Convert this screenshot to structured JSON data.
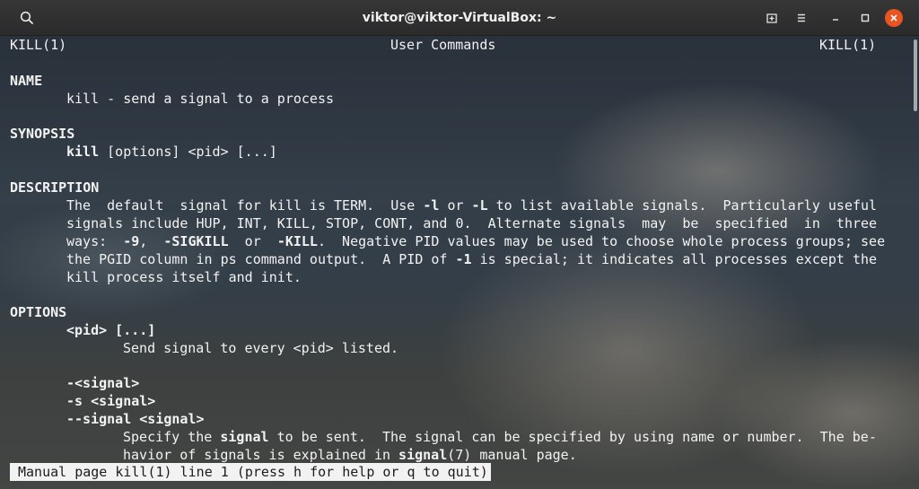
{
  "window": {
    "title": "viktor@viktor-VirtualBox: ~",
    "accent_color": "#e95420",
    "buttons": {
      "search_icon": "search-icon",
      "new_tab_icon": "new-tab-icon",
      "menu_icon": "hamburger-menu-icon",
      "minimize_icon": "minimize-icon",
      "maximize_icon": "maximize-icon",
      "close_icon": "close-icon"
    }
  },
  "man": {
    "header": {
      "left": "KILL(1)",
      "center": "User Commands",
      "right": "KILL(1)"
    },
    "name_heading": "NAME",
    "name_text": "kill - send a signal to a process",
    "synopsis_heading": "SYNOPSIS",
    "synopsis_cmd": "kill",
    "synopsis_args": " [options] <pid> [...]",
    "description_heading": "DESCRIPTION",
    "desc": {
      "l1a": "The  default  signal for kill is TERM.  Use ",
      "l1b": "-l",
      "l1c": " or ",
      "l1d": "-L",
      "l1e": " to list available signals.  Particularly useful",
      "l2": "signals include HUP, INT, KILL, STOP, CONT, and 0.  Alternate signals  may  be  specified  in  three",
      "l3a": "ways:  ",
      "l3b": "-9",
      "l3c": ",  ",
      "l3d": "-SIGKILL",
      "l3e": "  or  ",
      "l3f": "-KILL",
      "l3g": ".  Negative PID values may be used to choose whole process groups; see",
      "l4a": "the PGID column in ps command output.  A PID of ",
      "l4b": "-1",
      "l4c": " is special; it indicates all processes except the",
      "l5": "kill process itself and init."
    },
    "options_heading": "OPTIONS",
    "opt1_label": "<pid> [...]",
    "opt1_desc": "Send signal to every <pid> listed.",
    "opt2_label": "-<signal>",
    "opt3_label": "-s <signal>",
    "opt4_label": "--signal <signal>",
    "opt4": {
      "l1a": "Specify the ",
      "l1b": "signal",
      "l1c": " to be sent.  The signal can be specified by using name or number.  The be-",
      "l2a": "havior of signals is explained in ",
      "l2b": "signal",
      "l2c": "(7) manual page."
    },
    "status": "Manual page kill(1) line 1 (press h for help or q to quit)"
  }
}
